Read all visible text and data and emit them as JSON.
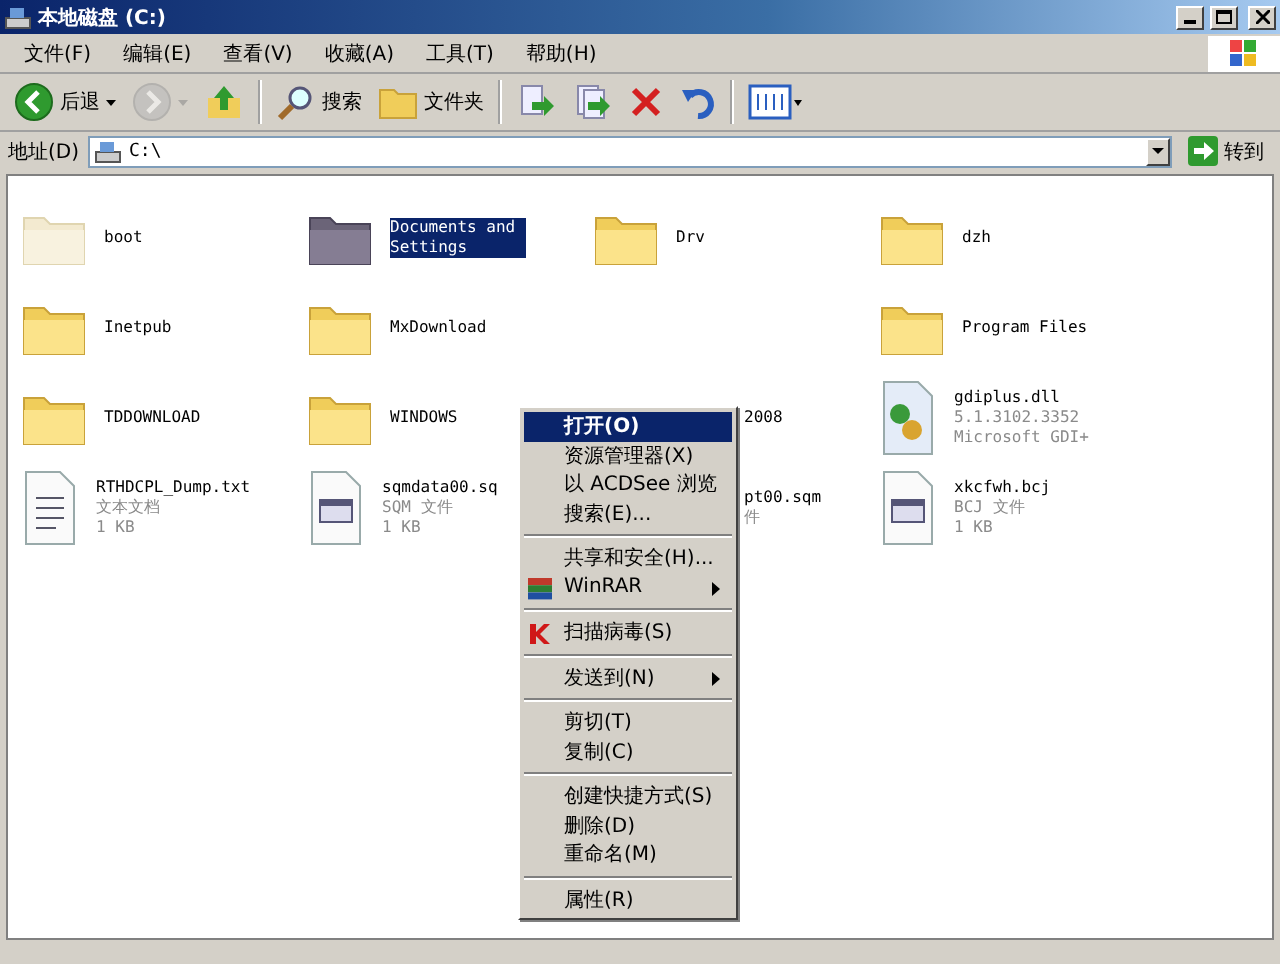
{
  "window": {
    "title": "本地磁盘 (C:)"
  },
  "menu_bar": [
    "文件(F)",
    "编辑(E)",
    "查看(V)",
    "收藏(A)",
    "工具(T)",
    "帮助(H)"
  ],
  "toolbar": [
    {
      "kind": "back",
      "label": "后退",
      "disabled": false
    },
    {
      "kind": "forward",
      "disabled": true
    },
    {
      "kind": "up",
      "disabled": false
    },
    {
      "kind": "search",
      "label": "搜索",
      "disabled": false
    },
    {
      "kind": "folders",
      "label": "文件夹",
      "disabled": false
    },
    {
      "kind": "move",
      "disabled": false
    },
    {
      "kind": "copy",
      "disabled": false
    },
    {
      "kind": "delete",
      "disabled": false
    },
    {
      "kind": "undo",
      "disabled": false
    },
    {
      "kind": "views",
      "disabled": false
    }
  ],
  "address_bar": {
    "label": "地址(D)",
    "value": "C:\\",
    "go_label": "转到"
  },
  "files": [
    {
      "kind": "folder-hidden",
      "name": "boot",
      "selected": false
    },
    {
      "kind": "folder",
      "name": "Documents and Settings",
      "selected": true
    },
    {
      "kind": "folder",
      "name": "Drv",
      "selected": false
    },
    {
      "kind": "folder",
      "name": "dzh",
      "selected": false
    },
    {
      "kind": "folder",
      "name": "Inetpub",
      "selected": false
    },
    {
      "kind": "folder",
      "name": "MxDownload",
      "selected": false
    },
    {
      "kind": "covered"
    },
    {
      "kind": "folder",
      "name": "Program Files",
      "selected": false
    },
    {
      "kind": "folder",
      "name": "TDDOWNLOAD",
      "selected": false
    },
    {
      "kind": "folder",
      "name": "WINDOWS",
      "selected": false
    },
    {
      "kind": "cut",
      "name": "2008",
      "selected": false
    },
    {
      "kind": "dll",
      "name": "gdiplus.dll",
      "details": [
        "5.1.3102.3352",
        "Microsoft GDI+"
      ],
      "selected": false
    },
    {
      "kind": "text",
      "name": "RTHDCPL_Dump.txt",
      "details": [
        "文本文档",
        "1 KB"
      ],
      "selected": false
    },
    {
      "kind": "data",
      "name": "sqmdata00.sq",
      "details": [
        "SQM 文件",
        "1 KB"
      ],
      "selected": false
    },
    {
      "kind": "cut",
      "name": "pt00.sqm",
      "details": [
        "件"
      ],
      "selected": false
    },
    {
      "kind": "data",
      "name": "xkcfwh.bcj",
      "details": [
        "BCJ 文件",
        "1 KB"
      ],
      "selected": false
    }
  ],
  "context_menu": [
    {
      "kind": "item",
      "label": "打开(O)",
      "default": true,
      "selected": true,
      "submenu": false
    },
    {
      "kind": "item",
      "label": "资源管理器(X)",
      "default": false,
      "selected": false,
      "submenu": false
    },
    {
      "kind": "item",
      "label": "以 ACDSee 浏览",
      "default": false,
      "selected": false,
      "submenu": false
    },
    {
      "kind": "item",
      "label": "搜索(E)...",
      "default": false,
      "selected": false,
      "submenu": false
    },
    {
      "kind": "separator"
    },
    {
      "kind": "item",
      "label": "共享和安全(H)...",
      "default": false,
      "selected": false,
      "submenu": false
    },
    {
      "kind": "archive",
      "label": "WinRAR",
      "default": false,
      "selected": false,
      "submenu": true
    },
    {
      "kind": "separator"
    },
    {
      "kind": "scan",
      "label": "扫描病毒(S)",
      "default": false,
      "selected": false,
      "submenu": false
    },
    {
      "kind": "separator"
    },
    {
      "kind": "item",
      "label": "发送到(N)",
      "default": false,
      "selected": false,
      "submenu": true
    },
    {
      "kind": "separator"
    },
    {
      "kind": "item",
      "label": "剪切(T)",
      "default": false,
      "selected": false,
      "submenu": false
    },
    {
      "kind": "item",
      "label": "复制(C)",
      "default": false,
      "selected": false,
      "submenu": false
    },
    {
      "kind": "separator"
    },
    {
      "kind": "item",
      "label": "创建快捷方式(S)",
      "default": false,
      "selected": false,
      "submenu": false
    },
    {
      "kind": "item",
      "label": "删除(D)",
      "default": false,
      "selected": false,
      "submenu": false
    },
    {
      "kind": "item",
      "label": "重命名(M)",
      "default": false,
      "selected": false,
      "submenu": false
    },
    {
      "kind": "separator"
    },
    {
      "kind": "item",
      "label": "属性(R)",
      "default": false,
      "selected": false,
      "submenu": false
    }
  ]
}
